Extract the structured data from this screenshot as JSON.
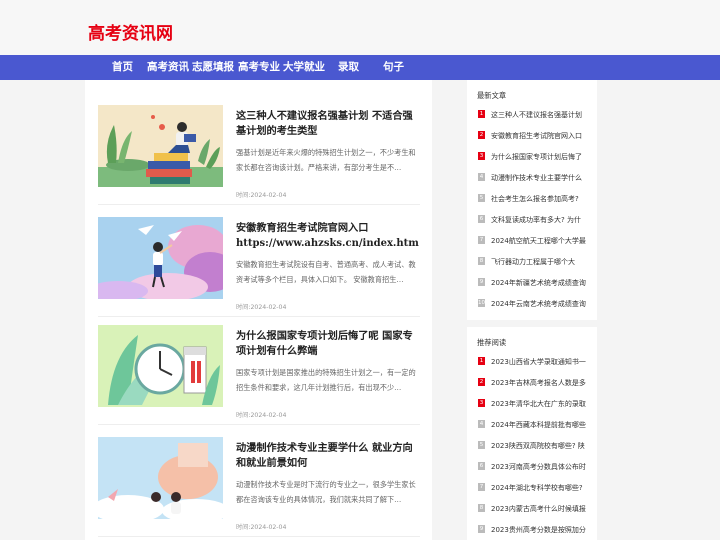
{
  "site": {
    "logo": "高考资讯网"
  },
  "nav": [
    "首页",
    "高考资讯",
    "志愿填报",
    "高考专业",
    "大学就业",
    "录取",
    "句子"
  ],
  "articles": [
    {
      "title": "这三种人不建议报名强基计划 不适合强基计划的考生类型",
      "url": "",
      "desc": "强基计划是近年来火爆的特殊招生计划之一，不少考生和家长都在咨询该计划。严格来讲，有部分考生是不…",
      "time": "时间:2024-02-04"
    },
    {
      "title": "安徽教育招生考试院官网入口",
      "url": "https://www.ahzsks.cn/index.htm",
      "desc": "安徽教育招生考试院设有自考、普通高考、成人考试、教资考试等多个栏目，具体入口如下。 安徽教育招生…",
      "time": "时间:2024-02-04"
    },
    {
      "title": "为什么报国家专项计划后悔了呢 国家专项计划有什么弊端",
      "url": "",
      "desc": "国家专项计划是国家推出的特殊招生计划之一，有一定的招生条件和要求，这几年计划推行后，有出现不少…",
      "time": "时间:2024-02-04"
    },
    {
      "title": "动漫制作技术专业主要学什么 就业方向和就业前景如何",
      "url": "",
      "desc": "动漫制作技术专业是时下流行的专业之一，很多学生家长都在咨询该专业的具体情况，我们就来共同了解下…",
      "time": "时间:2024-02-04"
    }
  ],
  "sidebar": {
    "latest": {
      "title": "最新文章",
      "items": [
        "这三种人不建议报名强基计划",
        "安徽教育招生考试院官网入口",
        "为什么报国家专项计划后悔了",
        "动漫制作技术专业主要学什么",
        "社会考生怎么报名参加高考?",
        "文科复读成功率有多大? 为什",
        "2024航空航天工程哪个大学最",
        "飞行器动力工程属于哪个大",
        "2024年新疆艺术统考成绩查询",
        "2024年云南艺术统考成绩查询"
      ]
    },
    "recommended": {
      "title": "推荐阅读",
      "items": [
        "2023山西省大学录取通知书一",
        "2023年吉林高考报名人数是多",
        "2023年清华北大在广东的录取",
        "2024年西藏本科提前批有哪些",
        "2023陕西双高院校有哪些? 陕",
        "2023河南高考分数具体公布时",
        "2024年湖北专科学校有哪些?",
        "2023内蒙古高考什么时候填报",
        "2023贵州高考分数是按照加分"
      ]
    }
  },
  "colors": {
    "accent": "#4a58d0",
    "logo": "#e60012",
    "badge_top": "#e60012",
    "badge_rest": "#bbbbbb"
  }
}
